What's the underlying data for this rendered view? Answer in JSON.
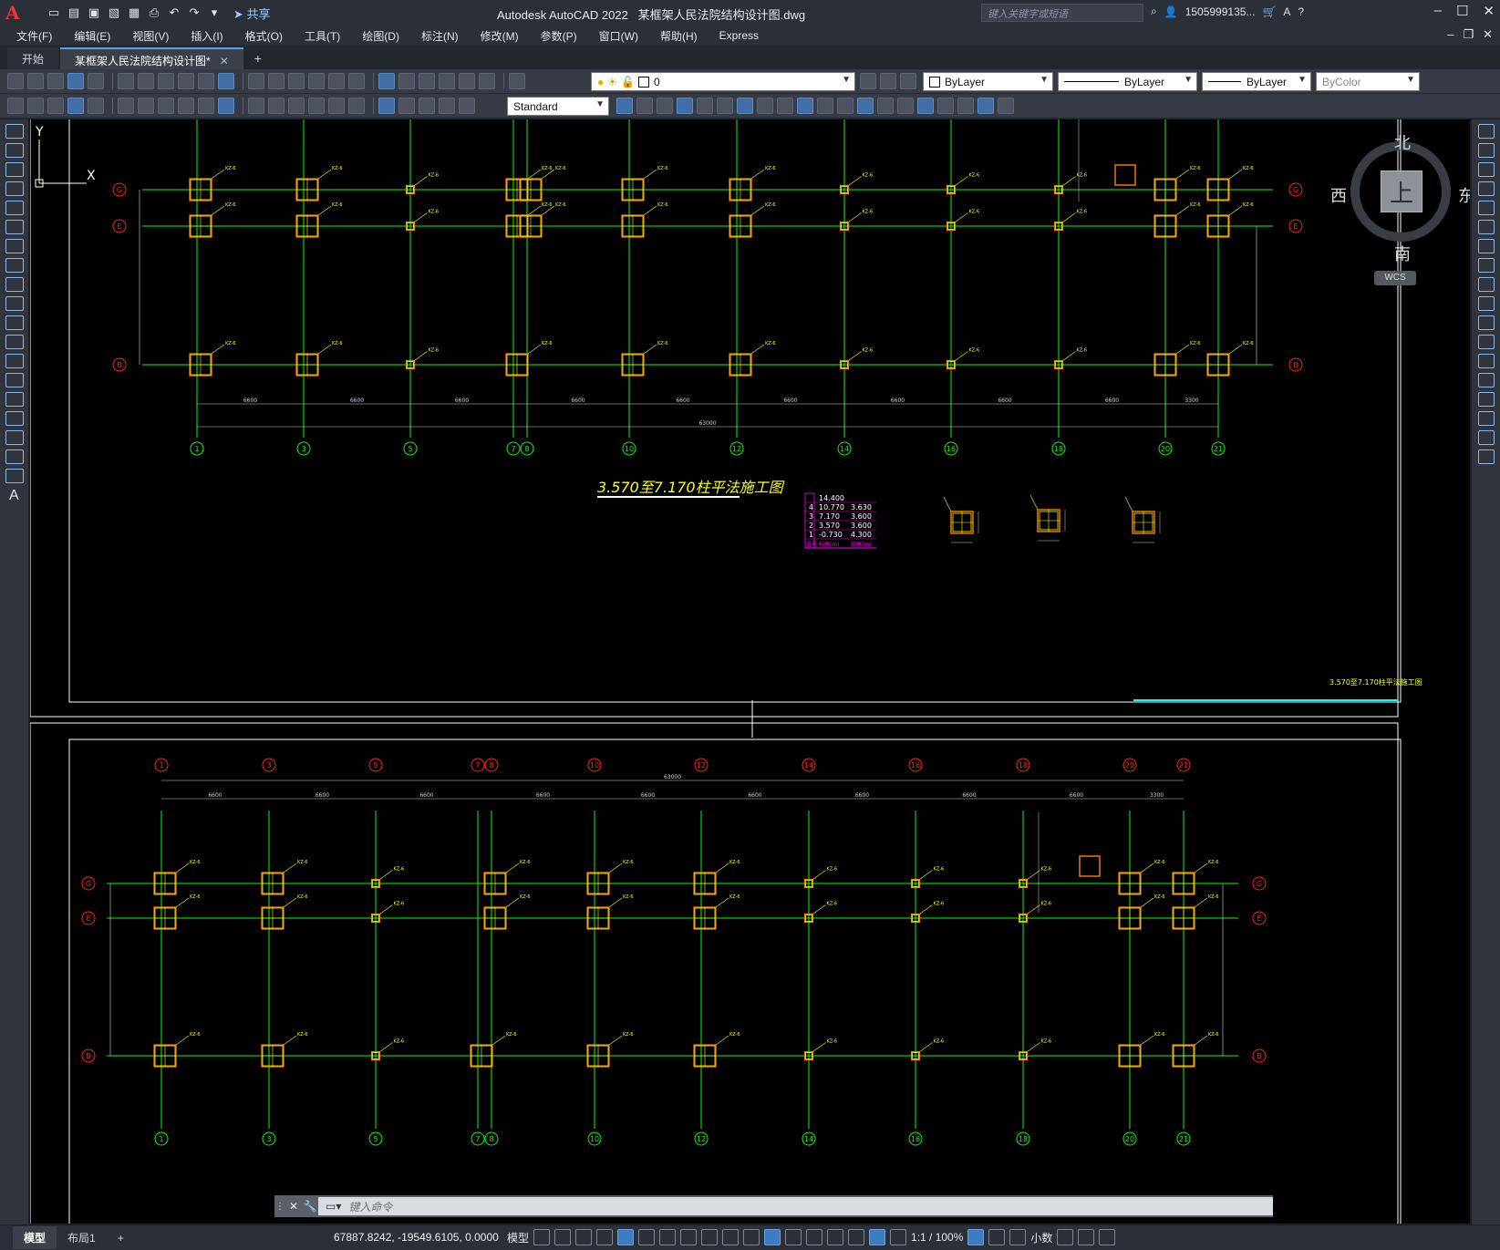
{
  "titlebar": {
    "app_name": "Autodesk AutoCAD 2022",
    "file_name": "某框架人民法院结构设计图.dwg",
    "share_label": "共享",
    "search_placeholder": "键入关键字或短语",
    "user": "1505999135...",
    "logo": "A"
  },
  "menu": [
    "文件(F)",
    "编辑(E)",
    "视图(V)",
    "插入(I)",
    "格式(O)",
    "工具(T)",
    "绘图(D)",
    "标注(N)",
    "修改(M)",
    "参数(P)",
    "窗口(W)",
    "帮助(H)",
    "Express"
  ],
  "tabs": [
    {
      "label": "开始"
    },
    {
      "label": "某框架人民法院结构设计图*"
    }
  ],
  "toolbar": {
    "layer_value": "0",
    "text_style": "Standard",
    "color": "ByLayer",
    "linetype": "ByLayer",
    "lineweight": "ByLayer",
    "plotstyle": "ByColor"
  },
  "viewcube": {
    "north": "北",
    "south": "南",
    "east": "东",
    "west": "西",
    "top": "上",
    "wcs": "WCS"
  },
  "drawing": {
    "top_title": "3.570至7.170柱平法施工图",
    "corner_label": "3.570至7.170柱平法施工图",
    "dim_span": "6600",
    "dim_last": "3300",
    "dim_total": "63000",
    "top_axes": [
      "1",
      "3",
      "5",
      "7",
      "8",
      "10",
      "12",
      "14",
      "16",
      "18",
      "20",
      "21"
    ],
    "bottom_axes": [
      "1",
      "3",
      "5",
      "7",
      "8",
      "10",
      "12",
      "14",
      "16",
      "18",
      "20",
      "21"
    ],
    "row_axes": [
      "G",
      "E",
      "B"
    ],
    "column_tag": "KZ-6",
    "level_table": [
      [
        "",
        "14.400",
        ""
      ],
      [
        "4",
        "10.770",
        "3.630"
      ],
      [
        "3",
        "7.170",
        "3.600"
      ],
      [
        "2",
        "3.570",
        "3.600"
      ],
      [
        "1",
        "-0.730",
        "4.300"
      ]
    ],
    "level_table_header": [
      "层号",
      "标高(m)",
      "层高(m)"
    ],
    "ucs_x": "X",
    "ucs_y": "Y"
  },
  "command": {
    "placeholder": "键入命令"
  },
  "status": {
    "tabs": [
      "模型",
      "布局1"
    ],
    "add": "+",
    "coords": "67887.8242, -19549.6105, 0.0000",
    "model": "模型",
    "scale": "1:1 / 100%",
    "units": "小数"
  },
  "colors": {
    "axis_green": "#00ff00",
    "column_yellow": "#ffff00",
    "column_orange": "#ff8000",
    "bubble_red": "#ff2020",
    "magenta": "#ff00ff",
    "cyan": "#00ffff"
  }
}
